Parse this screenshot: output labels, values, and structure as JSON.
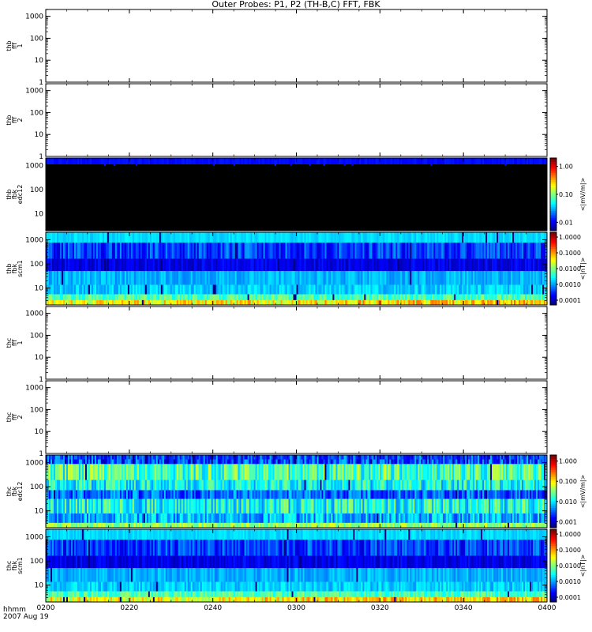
{
  "title": "Outer Probes: P1, P2 (TH-B,C) FFT, FBK",
  "x_axis": {
    "label_line1": "hhmm",
    "label_line2": "2007 Aug 19",
    "ticks": [
      "0200",
      "0220",
      "0240",
      "0300",
      "0320",
      "0340",
      "0400"
    ]
  },
  "colors": {
    "frame": "#000000",
    "background": "#ffffff"
  },
  "chart_data": [
    {
      "type": "heatmap",
      "ylabel": [
        "thb",
        "fff",
        "1"
      ],
      "yscale": "log",
      "yticks": [
        "1",
        "10",
        "100",
        "1000"
      ],
      "ylim": [
        1,
        2048
      ],
      "xlim": [
        "02:00",
        "04:00"
      ],
      "state": "empty",
      "colorbar": null
    },
    {
      "type": "heatmap",
      "ylabel": [
        "thb",
        "fff",
        "2"
      ],
      "yscale": "log",
      "yticks": [
        "1",
        "10",
        "100",
        "1000"
      ],
      "ylim": [
        1,
        2048
      ],
      "xlim": [
        "02:00",
        "04:00"
      ],
      "state": "empty",
      "colorbar": null
    },
    {
      "type": "heatmap",
      "ylabel": [
        "thb",
        "fbk",
        "edc12"
      ],
      "yscale": "log",
      "yticks": [
        "10",
        "100",
        "1000"
      ],
      "ylim": [
        2,
        2048
      ],
      "xlim": [
        "02:00",
        "04:00"
      ],
      "state": "filled",
      "pattern": "fbk_edc_thb",
      "colorbar": {
        "label": "<|mV/m|>",
        "ticks": [
          "1.00",
          "0.10",
          "0.01"
        ],
        "range": [
          0.005,
          2.0
        ]
      }
    },
    {
      "type": "heatmap",
      "ylabel": [
        "thb",
        "fbk",
        "scm1"
      ],
      "yscale": "log",
      "yticks": [
        "10",
        "100",
        "1000"
      ],
      "ylim": [
        2,
        2048
      ],
      "xlim": [
        "02:00",
        "04:00"
      ],
      "state": "filled",
      "pattern": "fbk_scm",
      "colorbar": {
        "label": "<|nT|>",
        "ticks": [
          "1.0000",
          "0.1000",
          "0.0100",
          "0.0010",
          "0.0001"
        ],
        "range": [
          5e-05,
          2.0
        ]
      }
    },
    {
      "type": "heatmap",
      "ylabel": [
        "thc",
        "fff",
        "1"
      ],
      "yscale": "log",
      "yticks": [
        "1",
        "10",
        "100",
        "1000"
      ],
      "ylim": [
        1,
        2048
      ],
      "xlim": [
        "02:00",
        "04:00"
      ],
      "state": "empty",
      "colorbar": null
    },
    {
      "type": "heatmap",
      "ylabel": [
        "thc",
        "fff",
        "2"
      ],
      "yscale": "log",
      "yticks": [
        "1",
        "10",
        "100",
        "1000"
      ],
      "ylim": [
        1,
        2048
      ],
      "xlim": [
        "02:00",
        "04:00"
      ],
      "state": "empty",
      "colorbar": null
    },
    {
      "type": "heatmap",
      "ylabel": [
        "thc",
        "fbk",
        "edc12"
      ],
      "yscale": "log",
      "yticks": [
        "10",
        "100",
        "1000"
      ],
      "ylim": [
        2,
        2048
      ],
      "xlim": [
        "02:00",
        "04:00"
      ],
      "state": "filled",
      "pattern": "fbk_edc_thc",
      "colorbar": {
        "label": "<|mV/m|>",
        "ticks": [
          "1.000",
          "0.100",
          "0.010",
          "0.001"
        ],
        "range": [
          0.0005,
          2.0
        ]
      }
    },
    {
      "type": "heatmap",
      "ylabel": [
        "thc",
        "fbk",
        "scm1"
      ],
      "yscale": "log",
      "yticks": [
        "10",
        "100",
        "1000"
      ],
      "ylim": [
        2,
        2048
      ],
      "xlim": [
        "02:00",
        "04:00"
      ],
      "state": "filled",
      "pattern": "fbk_scm",
      "colorbar": {
        "label": "<|nT|>",
        "ticks": [
          "1.0000",
          "0.1000",
          "0.0100",
          "0.0010",
          "0.0001"
        ],
        "range": [
          5e-05,
          2.0
        ]
      }
    }
  ]
}
